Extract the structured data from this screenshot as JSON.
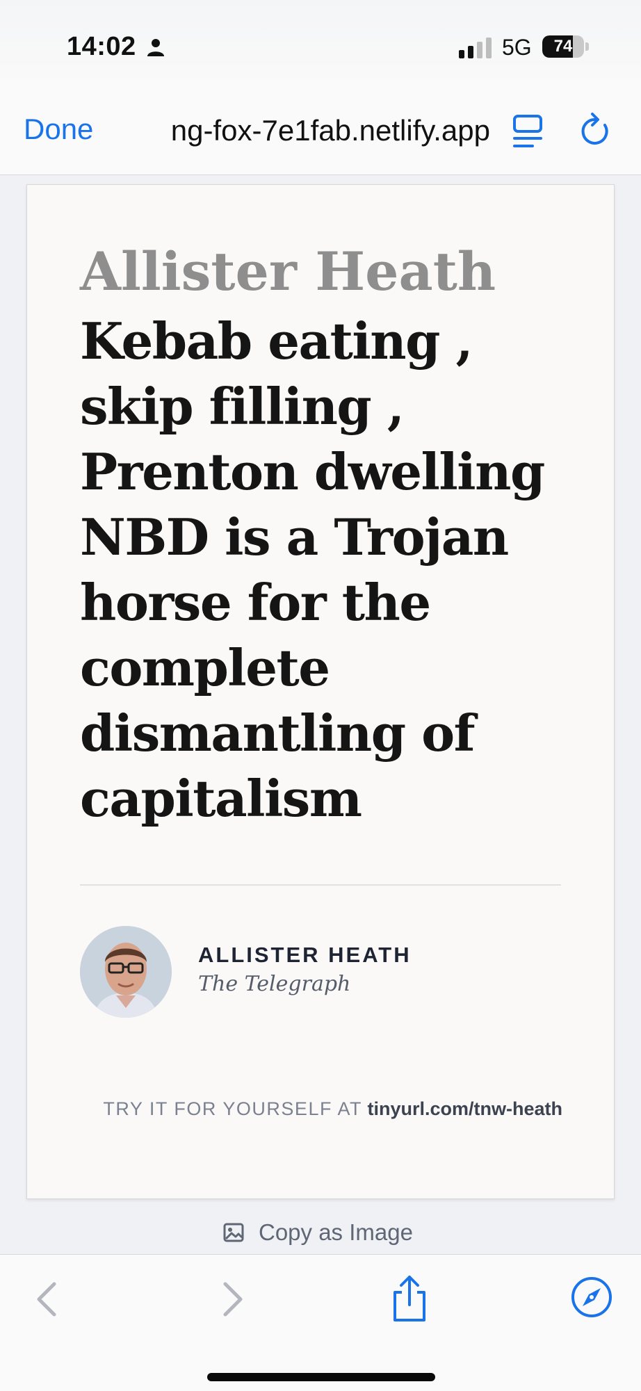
{
  "status_bar": {
    "time": "14:02",
    "network": "5G",
    "battery_percent": "74",
    "battery_level": 0.74
  },
  "browser": {
    "done_label": "Done",
    "url": "ng-fox-7e1fab.netlify.app",
    "copy_image_label": "Copy as Image"
  },
  "card": {
    "kicker": "Allister Heath",
    "headline": "Kebab eating , skip filling , Prenton dwelling NBD is a Trojan horse for the complete dismantling of capitalism",
    "author": "ALLISTER HEATH",
    "publication": "The Telegraph",
    "cta_text": "TRY IT FOR YOURSELF AT",
    "cta_link": "tinyurl.com/tnw-heath"
  },
  "colors": {
    "accent": "#1a73e8",
    "headline": "#151515",
    "kicker": "#8e8e8e",
    "card_background": "#faf9f7",
    "page_background": "#eff1f4"
  },
  "icons": {
    "status": [
      "person-icon",
      "signal-icon",
      "battery-icon"
    ],
    "top_bar": [
      "reader-icon",
      "reload-icon"
    ],
    "toolbar": [
      "back-icon",
      "forward-icon",
      "share-icon",
      "compass-icon"
    ],
    "copy": "image-icon"
  }
}
